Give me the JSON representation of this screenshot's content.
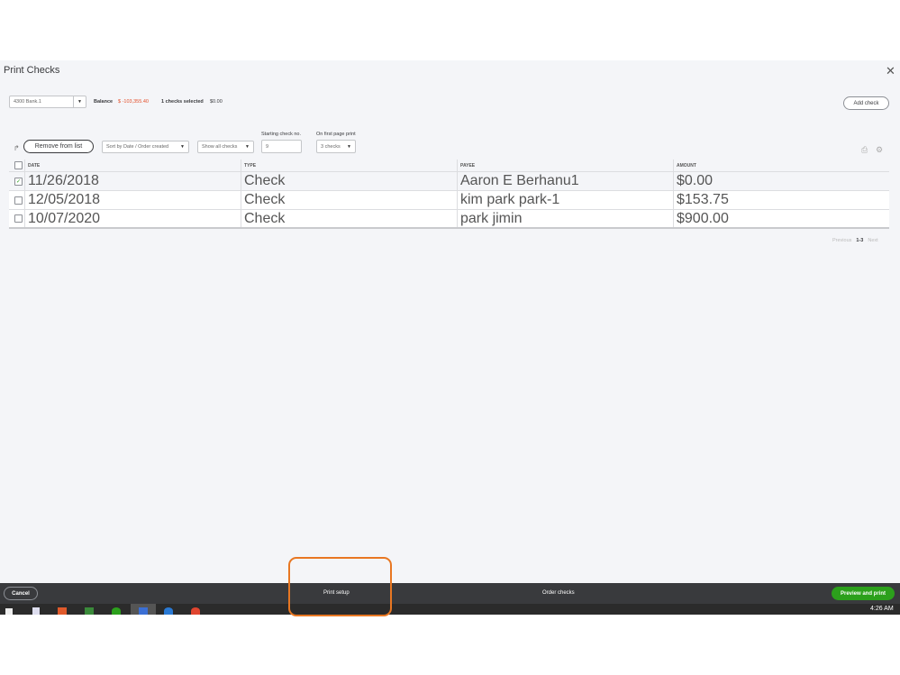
{
  "dialog": {
    "title": "Print Checks",
    "close_icon": "close-icon"
  },
  "account": {
    "selected": "4300 Bank.1",
    "balance_label": "Balance",
    "balance_value": "$ -103,355.40",
    "selected_count": "1 checks selected",
    "selected_total": "$0.00",
    "balance_color": "#e4502b"
  },
  "toolbar": {
    "add_check": "Add check",
    "remove_from_list": "Remove from list",
    "sort": "Sort by Date / Order created",
    "filter": "Show all checks",
    "starting_check_label": "Starting check no.",
    "starting_check_value": "9",
    "first_page_label": "On first page print",
    "first_page_value": "3 checks"
  },
  "table": {
    "headers": [
      "DATE",
      "TYPE",
      "PAYEE",
      "AMOUNT"
    ],
    "rows": [
      {
        "checked": true,
        "date": "11/26/2018",
        "type": "Check",
        "payee": "Aaron E Berhanu1",
        "amount": "$0.00"
      },
      {
        "checked": false,
        "date": "12/05/2018",
        "type": "Check",
        "payee": "kim park park-1",
        "amount": "$153.75"
      },
      {
        "checked": false,
        "date": "10/07/2020",
        "type": "Check",
        "payee": "park jimin",
        "amount": "$900.00"
      }
    ]
  },
  "pagination": {
    "previous": "Previous",
    "range": "1-3",
    "next": "Next"
  },
  "footer": {
    "cancel": "Cancel",
    "print_setup": "Print setup",
    "order_checks": "Order checks",
    "preview_print": "Preview and print",
    "accent": "#2ca01c",
    "highlight": "#e87722"
  },
  "taskbar": {
    "time": "4:26 AM"
  }
}
